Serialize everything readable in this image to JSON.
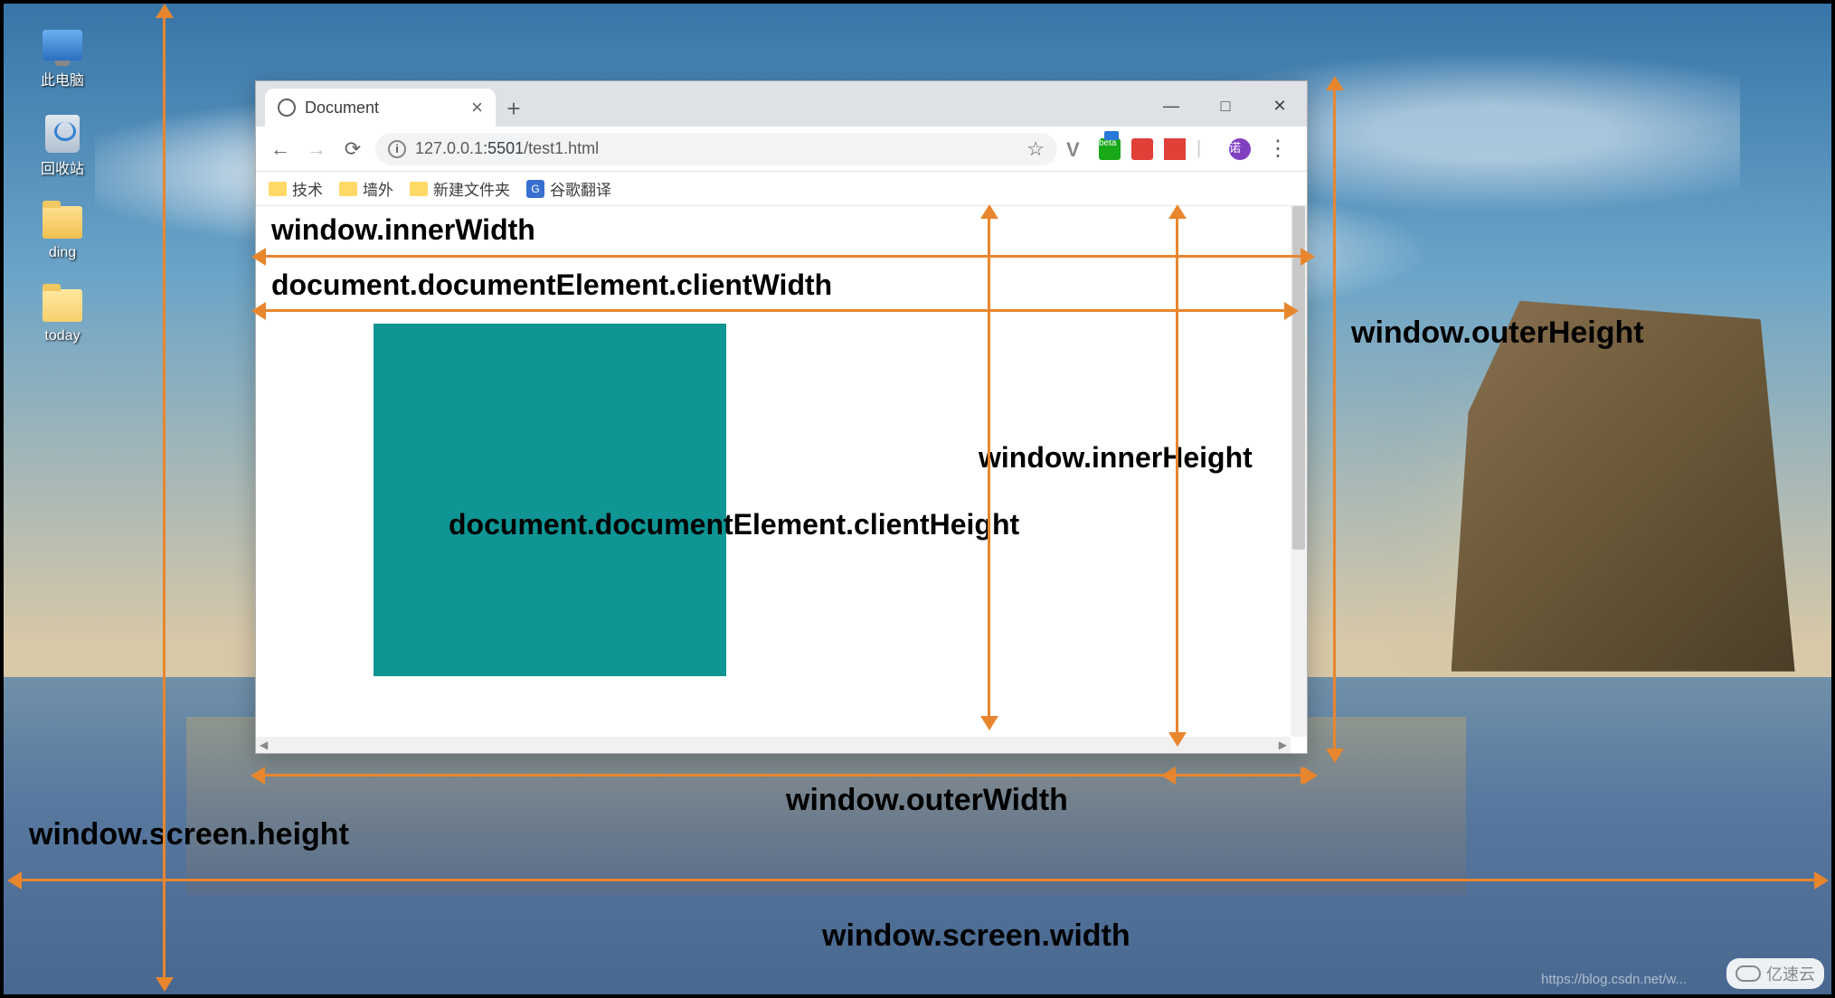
{
  "desktop": {
    "icons": [
      {
        "label": "此电脑",
        "type": "pc"
      },
      {
        "label": "回收站",
        "type": "bin"
      },
      {
        "label": "ding",
        "type": "folder"
      },
      {
        "label": "today",
        "type": "folder-open"
      }
    ]
  },
  "browser": {
    "tab_title": "Document",
    "window_controls": {
      "min": "—",
      "max": "□",
      "close": "✕"
    },
    "newtab": "+",
    "nav": {
      "back": "←",
      "fwd": "→",
      "reload": "⟳"
    },
    "url_info_icon": "ⓘ",
    "url_host": "127.0.0.1",
    "url_port": ":5501",
    "url_path": "/test1.html",
    "star": "☆",
    "ext": {
      "v": "V",
      "beta": "beta",
      "avatar": "诺",
      "dots": "⋮"
    },
    "bookmarks": [
      {
        "label": "技术",
        "type": "folder"
      },
      {
        "label": "墙外",
        "type": "folder"
      },
      {
        "label": "新建文件夹",
        "type": "folder"
      },
      {
        "label": "谷歌翻译",
        "type": "translate"
      }
    ],
    "hscroll_left": "◀",
    "hscroll_right": "▶"
  },
  "annotations": {
    "innerWidth": "window.innerWidth",
    "clientWidth": "document.documentElement.clientWidth",
    "innerHeight": "window.innerHeight",
    "clientHeight": "document.documentElement.clientHeight",
    "outerHeight": "window.outerHeight",
    "outerWidth": "window.outerWidth",
    "screenHeight": "window.screen.height",
    "screenWidth": "window.screen.width"
  },
  "watermark": {
    "text": "亿速云",
    "url": "https://blog.csdn.net/w..."
  }
}
